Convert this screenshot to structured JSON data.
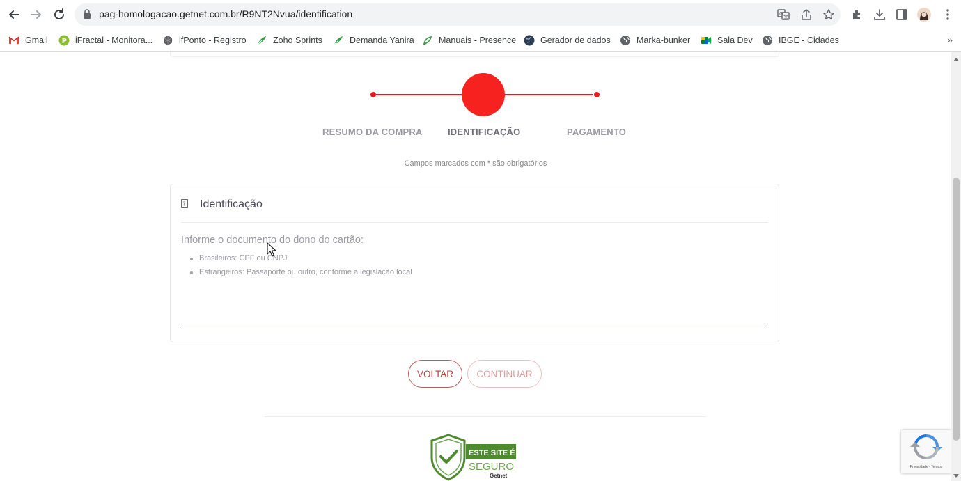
{
  "browser": {
    "url": "pag-homologacao.getnet.com.br/R9NT2Nvua/identification",
    "bookmarks": [
      {
        "label": "Gmail",
        "icon": "gmail-icon"
      },
      {
        "label": "iFractal - Monitora...",
        "icon": "ifractal-icon"
      },
      {
        "label": "ifPonto - Registro",
        "icon": "cube-icon"
      },
      {
        "label": "Zoho Sprints",
        "icon": "zoho-sprints-icon"
      },
      {
        "label": "Demanda Yanira",
        "icon": "zoho-sprints-icon"
      },
      {
        "label": "Manuais - Presence",
        "icon": "presence-icon"
      },
      {
        "label": "Gerador de dados",
        "icon": "globe-dark-icon"
      },
      {
        "label": "Marka-bunker",
        "icon": "globe-icon"
      },
      {
        "label": "Sala Dev",
        "icon": "google-meet-icon"
      },
      {
        "label": "IBGE - Cidades",
        "icon": "globe-icon"
      }
    ],
    "more_bookmarks": "»"
  },
  "stepper": {
    "steps": [
      {
        "label": "RESUMO DA COMPRA",
        "state": "done"
      },
      {
        "label": "IDENTIFICAÇÃO",
        "state": "active"
      },
      {
        "label": "PAGAMENTO",
        "state": "pending"
      }
    ],
    "color": "#e31c24"
  },
  "form": {
    "required_note": "Campos marcados com * são obrigatórios",
    "card_title": "Identificação",
    "card_icon": "document-icon",
    "instruction": "Informe o documento do dono do cartão:",
    "bullets": [
      "Brasileiros: CPF ou CNPJ",
      "Estrangeiros: Passaporte ou outro, conforme a legislação local"
    ],
    "input_value": "",
    "accent": "#c0494b"
  },
  "actions": {
    "back_label": "VOLTAR",
    "continue_label": "CONTINUAR"
  },
  "footer": {
    "seal_line1": "ESTE SITE É",
    "seal_line2": "SEGURO",
    "seal_brand": "Getnet",
    "seal_color": "#4e8a2e"
  },
  "recaptcha": {
    "terms": "Privacidade - Termos"
  }
}
